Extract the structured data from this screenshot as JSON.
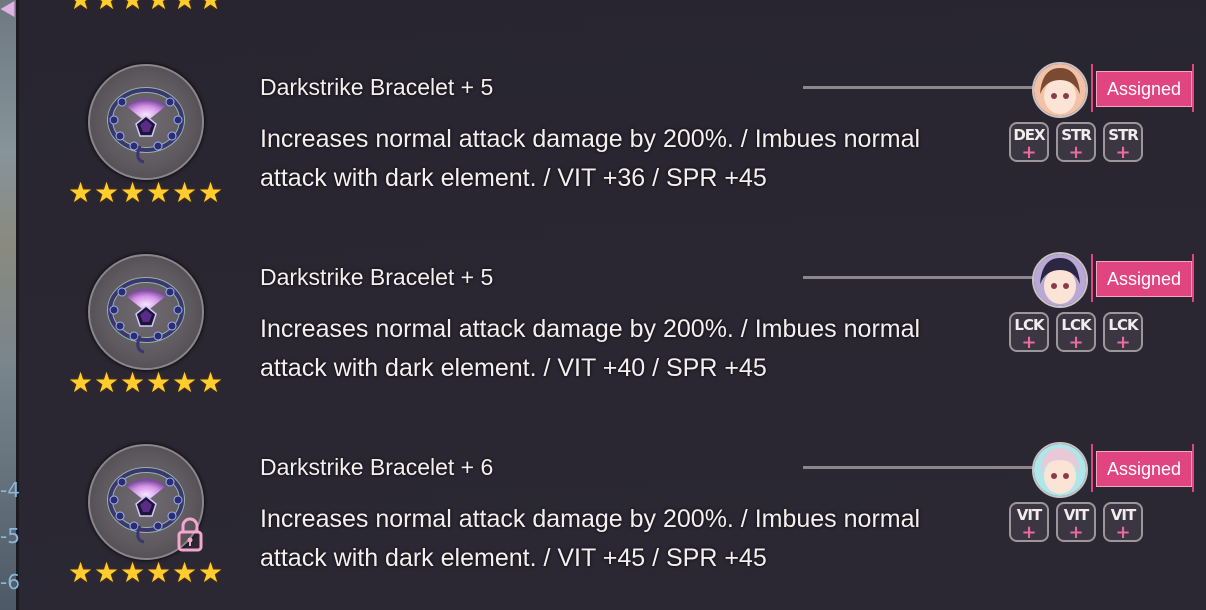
{
  "side_numbers": [
    "-4",
    "-5",
    "-6"
  ],
  "top_partial": {
    "stars": 6,
    "text": ""
  },
  "items": [
    {
      "name": "Darkstrike Bracelet + 5",
      "desc_line1": "Increases normal attack damage by 200%. / Imbues normal",
      "desc_line2": "attack with dark element. / VIT +36 / SPR +45",
      "stars": 6,
      "locked": false,
      "status": "Assigned",
      "avatar": "brown-hair-character-avatar",
      "slots": [
        "DEX",
        "STR",
        "STR"
      ]
    },
    {
      "name": "Darkstrike Bracelet + 5",
      "desc_line1": "Increases normal attack damage by 200%. / Imbues normal",
      "desc_line2": "attack with dark element. / VIT +40 / SPR +45",
      "stars": 6,
      "locked": false,
      "status": "Assigned",
      "avatar": "dark-hair-character-avatar",
      "slots": [
        "LCK",
        "LCK",
        "LCK"
      ]
    },
    {
      "name": "Darkstrike Bracelet + 6",
      "desc_line1": "Increases normal attack damage by 200%. / Imbues normal",
      "desc_line2": "attack with dark element. / VIT +45 / SPR +45",
      "stars": 6,
      "locked": true,
      "status": "Assigned",
      "avatar": "pink-hair-character-avatar",
      "slots": [
        "VIT",
        "VIT",
        "VIT"
      ]
    }
  ],
  "colors": {
    "assigned_bg": "#e0457f",
    "star": "#ffce2e",
    "slot_plus": "#e86aa0"
  }
}
